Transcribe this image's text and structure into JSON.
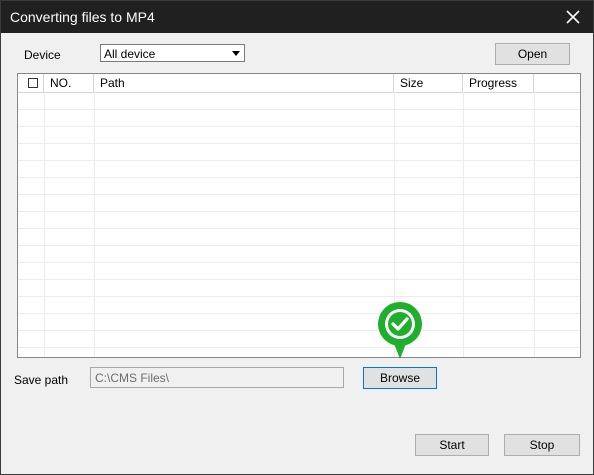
{
  "window": {
    "title": "Converting files to MP4"
  },
  "device": {
    "label": "Device",
    "selected": "All device"
  },
  "buttons": {
    "open": "Open",
    "browse": "Browse",
    "start": "Start",
    "stop": "Stop"
  },
  "table": {
    "columns": [
      "NO.",
      "Path",
      "Size",
      "Progress"
    ],
    "rows": []
  },
  "save_path": {
    "label": "Save path",
    "value": "C:\\CMS Files\\"
  },
  "icons": {
    "close": "close-icon",
    "dropdown": "chevron-down-icon",
    "badge": "check-badge-icon"
  },
  "colors": {
    "titlebar": "#202020",
    "badge_green": "#1fae2d",
    "focus_blue": "#0078d7"
  }
}
